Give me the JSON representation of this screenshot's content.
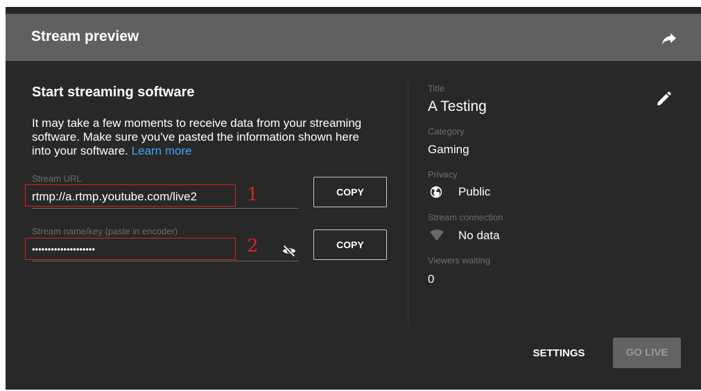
{
  "header": {
    "title": "Stream preview",
    "icon": "share-icon"
  },
  "setup": {
    "title": "Start streaming software",
    "description": "It may take a few moments to receive data from your streaming software. Make sure you've pasted the information shown here into your software.",
    "learn_more": "Learn more",
    "stream_url": {
      "label": "Stream URL",
      "value": "rtmp://a.rtmp.youtube.com/live2",
      "copy_label": "COPY"
    },
    "stream_key": {
      "label": "Stream name/key (paste in encoder)",
      "value": "••••••••••••••••••••",
      "copy_label": "COPY",
      "visibility_icon": "eye-off-icon"
    }
  },
  "annotations": {
    "url_number": "1",
    "key_number": "2",
    "color": "#e02020"
  },
  "details": {
    "title_label": "Title",
    "title_value": "A Testing",
    "category_label": "Category",
    "category_value": "Gaming",
    "privacy_label": "Privacy",
    "privacy_value": "Public",
    "connection_label": "Stream connection",
    "connection_value": "No data",
    "viewers_label": "Viewers waiting",
    "viewers_value": "0",
    "edit_icon": "pencil-icon"
  },
  "footer": {
    "settings_label": "SETTINGS",
    "go_live_label": "GO LIVE"
  },
  "colors": {
    "background": "#282828",
    "header": "#606060",
    "link": "#3ea6ff",
    "muted_text": "#6e6e6e",
    "disabled_button": "#636363"
  }
}
